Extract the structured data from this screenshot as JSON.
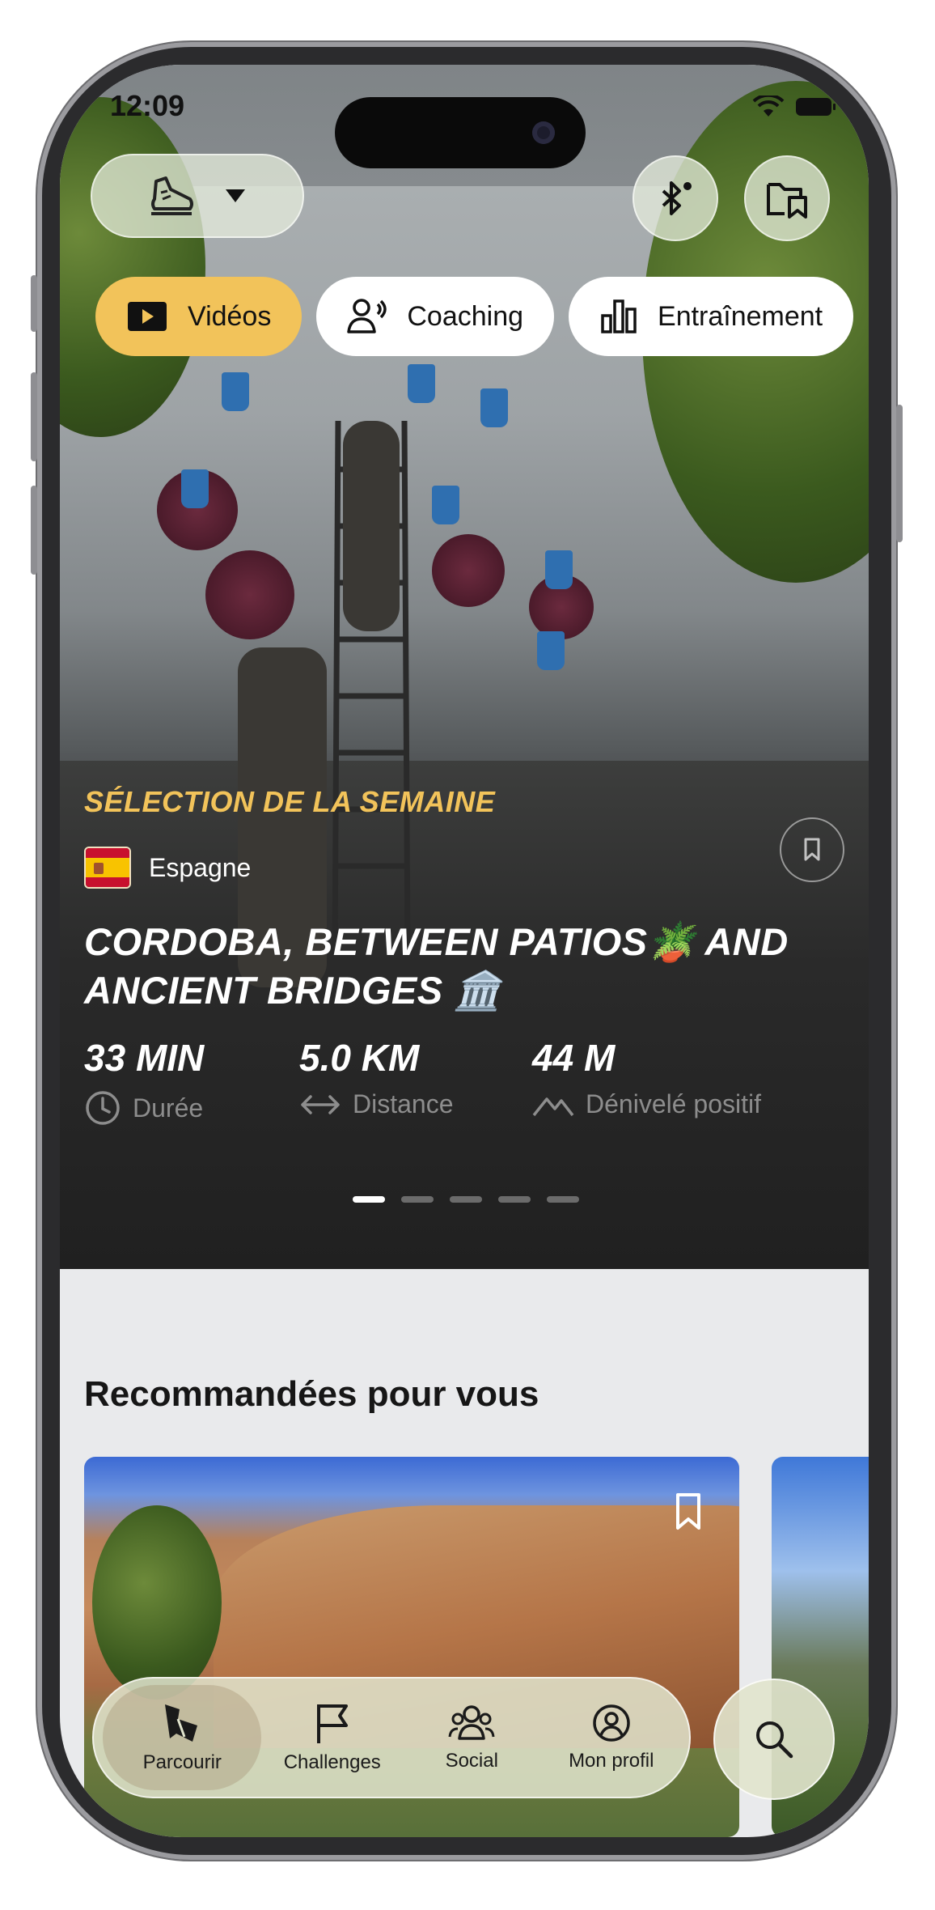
{
  "status_bar": {
    "time": "12:09"
  },
  "top_tabs": [
    {
      "label": "Vidéos",
      "icon": "play-icon",
      "active": true
    },
    {
      "label": "Coaching",
      "icon": "coach-icon",
      "active": false
    },
    {
      "label": "Entraînement",
      "icon": "bar-chart-icon",
      "active": false
    }
  ],
  "featured": {
    "eyebrow": "SÉLECTION DE LA SEMAINE",
    "country": "Espagne",
    "title_line1": "CORDOBA, BETWEEN PATIOS🪴  AND",
    "title_line2": "ANCIENT BRIDGES 🏛️",
    "stats": [
      {
        "value": "33 MIN",
        "label": "Durée",
        "icon": "clock-icon"
      },
      {
        "value": "5.0 KM",
        "label": "Distance",
        "icon": "distance-arrows-icon"
      },
      {
        "value": "44 M",
        "label": "Dénivelé positif",
        "icon": "elevation-icon"
      }
    ],
    "carousel_pages": 5,
    "carousel_current": 1
  },
  "recommended": {
    "title": "Recommandées pour vous"
  },
  "bottom_nav": [
    {
      "label": "Parcourir",
      "icon": "browse-icon",
      "active": true
    },
    {
      "label": "Challenges",
      "icon": "flag-icon",
      "active": false
    },
    {
      "label": "Social",
      "icon": "people-icon",
      "active": false
    },
    {
      "label": "Mon profil",
      "icon": "profile-icon",
      "active": false
    }
  ],
  "colors": {
    "accent": "#f2c35a",
    "nav_glass": "#e1e4cd"
  }
}
